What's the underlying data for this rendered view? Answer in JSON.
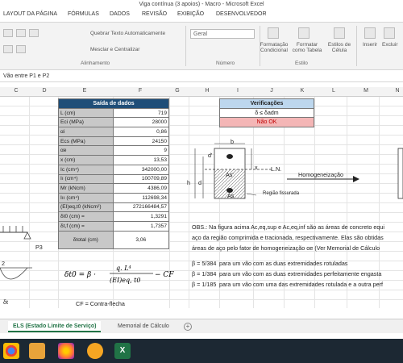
{
  "window": {
    "title": "Viga contínua (3 apoios) - Macro - Microsoft Excel"
  },
  "ribbon_tabs": [
    "LAYOUT DA PÁGINA",
    "FÓRMULAS",
    "DADOS",
    "REVISÃO",
    "EXIBIÇÃO",
    "DESENVOLVEDOR"
  ],
  "ribbon": {
    "wrap_text": "Quebrar Texto Automaticamente",
    "merge_center": "Mesclar e Centralizar",
    "number_format": "Geral",
    "alignment_group": "Alinhamento",
    "number_group": "Número",
    "cond_format": "Formatação Condicional",
    "format_table": "Formatar como Tabela",
    "cell_styles": "Estilos de Célula",
    "styles_group": "Estilo",
    "insert": "Inserir",
    "delete": "Excluir"
  },
  "formula_bar": {
    "content": "Vão entre P1 e P2"
  },
  "columns": [
    "C",
    "D",
    "E",
    "F",
    "G",
    "H",
    "I",
    "J",
    "K",
    "L",
    "M",
    "N"
  ],
  "output_table": {
    "title": "Saída de dados",
    "rows": [
      {
        "label": "L (cm)",
        "value": "719"
      },
      {
        "label": "Eci (MPa)",
        "value": "28000"
      },
      {
        "label": "αi",
        "value": "0,86"
      },
      {
        "label": "Ecs (MPa)",
        "value": "24150"
      },
      {
        "label": "αe",
        "value": "9"
      },
      {
        "label": "x (cm)",
        "value": "13,53"
      },
      {
        "label": "Ic (cm⁴)",
        "value": "342000,00"
      },
      {
        "label": "Iı (cm⁴)",
        "value": "100709,89"
      },
      {
        "label": "Mr (kNcm)",
        "value": "4386,09"
      },
      {
        "label": "Iıı (cm⁴)",
        "value": "112698,34"
      },
      {
        "label": "(EI)eq,t0 (kNcm²)",
        "value": "272166484,57"
      },
      {
        "label": "δt0 (cm) =",
        "value": "1,3291"
      },
      {
        "label": "δt,f (cm) =",
        "value": "1,7357"
      },
      {
        "label": "δtotal (cm)",
        "value": "3,06"
      }
    ]
  },
  "verifications": {
    "title": "Verificações",
    "condition": "δ ≤ δadm",
    "result": "Não OK"
  },
  "diagram": {
    "b": "b",
    "h": "h",
    "d": "d",
    "d_prime": "d'",
    "x": "x",
    "as_prime": "As'",
    "as": "As",
    "ln": "L.N.",
    "cracked": "Região fissurada",
    "homog": "Homogeneização"
  },
  "left_labels": {
    "p3": "P3",
    "two": "2",
    "dt": "δt"
  },
  "formula": {
    "cf_note": "CF = Contra-flecha"
  },
  "obs": {
    "line1": "OBS.: Na figura acima Ac,eq,sup e Ac,eq,inf são as áreas de concreto equi",
    "line2": "aço da região comprimida e tracionada, respectivamente. Elas são obtidas",
    "line3": "áreas de aço pelo fator de homogeneização αe (Ver Memorial de Cálculo"
  },
  "beta": [
    {
      "coef": "β = 5/384",
      "text": "para um vão com as duas extremidades rotuladas"
    },
    {
      "coef": "β = 1/384",
      "text": "para um vão com as duas extremidades perfeitamente engasta"
    },
    {
      "coef": "β = 1/185",
      "text": "para um vão com uma das extremidades rotulada e a outra perf"
    }
  ],
  "sheet_tabs": [
    "ELS (Estado Limite de Serviço)",
    "Memorial de Cálculo"
  ],
  "colors": {
    "excel_green": "#217346",
    "header_blue": "#1f4e78",
    "verif_blue": "#bdd7ee",
    "notok_red": "#f4b6b6"
  }
}
